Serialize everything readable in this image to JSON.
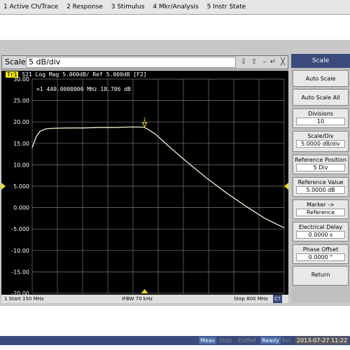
{
  "menu": [
    "1 Active Ch/Trace",
    "2 Response",
    "3 Stimulus",
    "4 Mkr/Analysis",
    "5 Instr State"
  ],
  "entry": {
    "label": "Scale",
    "value": "5 dB/div",
    "btn_down": "⇩",
    "btn_up": "⇧",
    "btn_minus": "–",
    "btn_enter": "↵",
    "btn_close": "╳"
  },
  "trace_header": {
    "tag": "Tr1",
    "text": "S21 Log Mag 5.000dB/ Ref 5.000dB [F2]"
  },
  "marker_readout": ">1  440.0000000 MHz  18.706 dB",
  "marker_label": "1",
  "y_labels": [
    "30.00",
    "25.00",
    "20.00",
    "15.00",
    "10.00",
    "5.000",
    "0.000",
    "-5.000",
    "-10.00",
    "-15.00",
    "-20.00"
  ],
  "status": {
    "start": "1  Start 150 MHz",
    "ifbw": "IFBW 70 kHz",
    "stop": "Stop 800 MHz",
    "ch": "C?"
  },
  "softkeys": {
    "title": "Scale",
    "items": [
      {
        "label": "Auto Scale",
        "value": ""
      },
      {
        "label": "Auto Scale All",
        "value": ""
      },
      {
        "label": "Divisions",
        "value": "10"
      },
      {
        "label": "Scale/Div",
        "value": "5.0000 dB/div"
      },
      {
        "label": "Reference Position",
        "value": "5 Div"
      },
      {
        "label": "Reference Value",
        "value": "5.0000 dB"
      },
      {
        "label": "Marker ->",
        "value": "Reference"
      },
      {
        "label": "Electrical Delay",
        "value": "0.0000 s"
      },
      {
        "label": "Phase Offset",
        "value": "0.0000 °"
      },
      {
        "label": "Return",
        "value": ""
      }
    ]
  },
  "bottom": {
    "meas": "Meas",
    "stop": "Stop",
    "extref": "ExtRef",
    "ready": "Ready",
    "svc": "Svc",
    "datetime": "2013-07-27 11:22"
  },
  "chart_data": {
    "type": "line",
    "title": "S21 Log Mag",
    "xlabel": "",
    "ylabel": "",
    "xlim": [
      150,
      800
    ],
    "ylim": [
      -20,
      30
    ],
    "y_ticks": [
      30,
      25,
      20,
      15,
      10,
      5,
      0,
      -5,
      -10,
      -15,
      -20
    ],
    "reference_level": 5,
    "series": [
      {
        "name": "S21",
        "x": [
          150,
          160,
          170,
          185,
          200,
          240,
          280,
          320,
          360,
          400,
          430,
          440,
          450,
          470,
          500,
          550,
          600,
          650,
          700,
          750,
          800
        ],
        "y": [
          14.0,
          16.5,
          17.8,
          18.4,
          18.5,
          18.6,
          18.6,
          18.7,
          18.7,
          18.8,
          18.8,
          18.7,
          18.2,
          17.0,
          14.5,
          10.6,
          6.9,
          3.5,
          0.4,
          -2.5,
          -4.7
        ]
      }
    ],
    "marker": {
      "x": 440,
      "y": 18.706
    },
    "colors": {
      "trace": "#f0f0d0",
      "grid": "#7a7a7a",
      "background": "#000000",
      "ref_marker": "#f0e000"
    }
  }
}
